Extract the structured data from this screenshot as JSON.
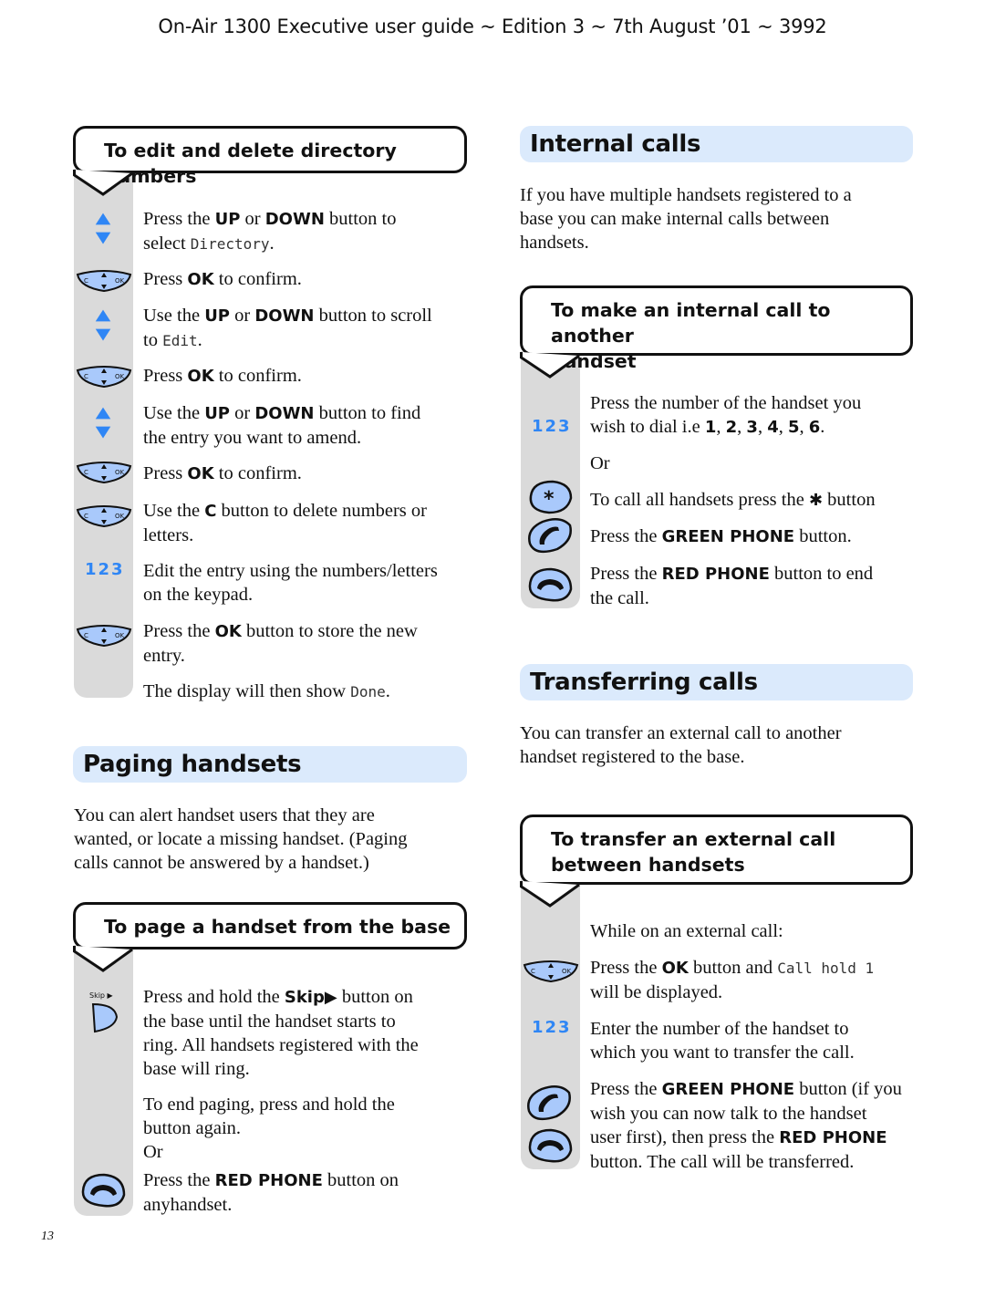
{
  "header": {
    "title": "On-Air 1300 Executive user guide ~ Edition 3 ~ 7th August ’01 ~ 3992"
  },
  "page_number": "13",
  "colors": {
    "band": "#dbeafc",
    "icon_fill": "#a9c9fb",
    "arrow_blue": "#2f86f5",
    "column_gray": "#dadada"
  },
  "left": {
    "edit_box": {
      "title": "To edit and delete directory numbers",
      "steps": [
        {
          "icon": "up-down-arrows-icon",
          "pre": "Press the ",
          "k1": "UP",
          "mid": " or ",
          "k2": "DOWN",
          "post": " button to",
          "line2pre": "select ",
          "lcd": "Directory",
          "line2post": "."
        },
        {
          "icon": "navigation-ok-key-icon",
          "pre": "Press ",
          "k1": "OK",
          "post": " to confirm."
        },
        {
          "icon": "up-down-arrows-icon",
          "pre": "Use the ",
          "k1": "UP",
          "mid": " or ",
          "k2": "DOWN",
          "post": " button to scroll",
          "line2pre": "to ",
          "lcd": "Edit",
          "line2post": "."
        },
        {
          "icon": "navigation-ok-key-icon",
          "pre": "Press ",
          "k1": "OK",
          "post": " to confirm."
        },
        {
          "icon": "up-down-arrows-icon",
          "pre": "Use the ",
          "k1": "UP",
          "mid": " or ",
          "k2": "DOWN",
          "post": " button to find",
          "line2": "the entry you want to amend."
        },
        {
          "icon": "navigation-ok-key-icon",
          "pre": "Press ",
          "k1": "OK",
          "post": " to confirm."
        },
        {
          "icon": "navigation-ok-key-icon",
          "pre": "Use the ",
          "k1": "C",
          "post": " button to delete numbers or",
          "line2": "letters."
        },
        {
          "icon": "keypad-123-icon",
          "label": "123",
          "line1": "Edit the entry using the numbers/letters",
          "line2": "on the keypad."
        },
        {
          "icon": "navigation-ok-key-icon",
          "pre": "Press the ",
          "k1": "OK",
          "post": " button to store the new",
          "line2": "entry."
        },
        {
          "pre": "The display will then show ",
          "lcd": "Done",
          "post": "."
        }
      ]
    },
    "paging": {
      "heading": "Paging handsets",
      "intro": [
        "You can alert handset users that they are",
        "wanted, or locate a missing handset. (Paging",
        "calls cannot be answered by a handset.)"
      ],
      "box_title": "To page a handset from the base",
      "skip_label": "Skip",
      "step1": {
        "pre": "Press and hold the ",
        "k1": "Skip▶",
        "post": " button on",
        "lines": [
          "the base until the handset starts to",
          "ring. All handsets registered with the",
          "base will ring."
        ]
      },
      "step2": [
        "To end paging, press and hold the",
        "button again."
      ],
      "or": "Or",
      "step3": {
        "pre": "Press the ",
        "k1": "RED PHONE",
        "post": " button on",
        "line2": "anyhandset."
      }
    }
  },
  "right": {
    "internal": {
      "heading": "Internal calls",
      "intro": [
        "If you have multiple handsets registered to a",
        "base you can make internal calls between",
        "handsets."
      ],
      "box_title_1": "To make an internal call to another",
      "box_title_2": "handset",
      "step1": {
        "label": "123",
        "line1": "Press the number of the handset you",
        "pre": "wish to dial i.e ",
        "nums": [
          "1",
          "2",
          "3",
          "4",
          "5",
          "6"
        ]
      },
      "or": "Or",
      "step2": {
        "pre": "To call all handsets press the ",
        "star": "✱",
        "post": " button"
      },
      "step3": {
        "pre": "Press the ",
        "k1": "GREEN PHONE",
        "post": " button."
      },
      "step4": {
        "pre": "Press the ",
        "k1": "RED PHONE",
        "post": " button to end",
        "line2": "the call."
      }
    },
    "transfer": {
      "heading": "Transferring calls",
      "intro": [
        "You can transfer an external call to another",
        "handset registered to the base."
      ],
      "box_title_1": "To transfer an external call",
      "box_title_2": "between handsets",
      "step0": "While on an external call:",
      "step1": {
        "pre": "Press the ",
        "k1": "OK",
        "post": " button and ",
        "lcd": "Call hold 1",
        "line2": "will be displayed."
      },
      "step2": {
        "label": "123",
        "line1": "Enter the number of the handset to",
        "line2": "which you want to transfer the call."
      },
      "step3": {
        "pre": "Press the ",
        "k1": "GREEN PHONE",
        "post": " button (if you",
        "line2": "wish you can now talk to the handset",
        "line3pre": "user first), then press the ",
        "k2": "RED PHONE",
        "line4": "button. The call will be transferred."
      }
    }
  }
}
